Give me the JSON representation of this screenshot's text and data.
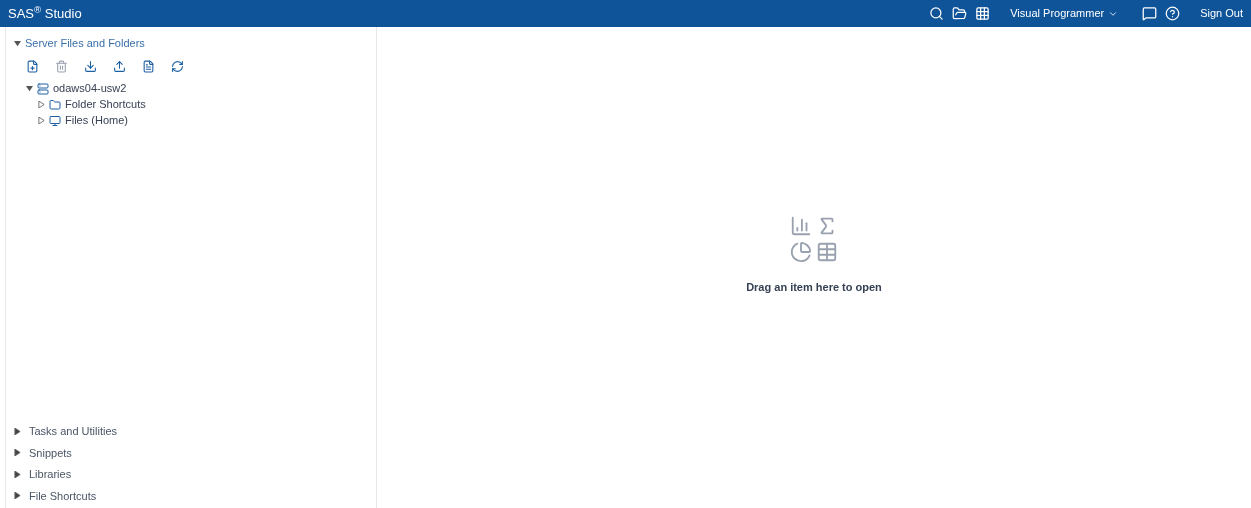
{
  "header": {
    "title": "SAS$^{®}$ Studio",
    "perspective": "Visual Programmer",
    "sign_out": "Sign Out"
  },
  "sidebar": {
    "sections": [
      {
        "label": "Server Files and Folders",
        "expanded": true,
        "tree": [
          {
            "label": "odaws04-usw2",
            "kind": "server",
            "expanded": true,
            "children": [
              {
                "label": "Folder Shortcuts",
                "kind": "folder",
                "expanded": false
              },
              {
                "label": "Files (Home)",
                "kind": "home",
                "expanded": false
              }
            ]
          }
        ]
      },
      {
        "label": "Tasks and Utilities",
        "expanded": false
      },
      {
        "label": "Snippets",
        "expanded": false
      },
      {
        "label": "Libraries",
        "expanded": false
      },
      {
        "label": "File Shortcuts",
        "expanded": false
      }
    ]
  },
  "workspace": {
    "message": "Drag an item here to open"
  }
}
